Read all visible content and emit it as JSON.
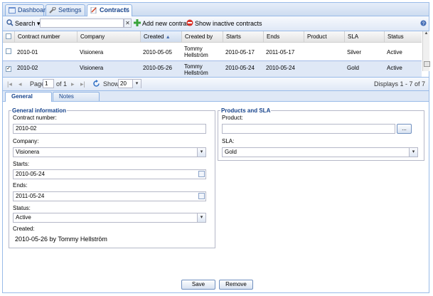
{
  "tabs": [
    {
      "label": "Dashboard",
      "icon": "dashboard-icon"
    },
    {
      "label": "Settings",
      "icon": "wrench-icon"
    },
    {
      "label": "Contracts",
      "icon": "contract-icon",
      "active": true
    }
  ],
  "toolbar": {
    "search_label": "Search",
    "search_value": "",
    "add_label": "Add new contract",
    "inactive_label": "Show inactive contracts"
  },
  "grid": {
    "columns": [
      "Contract number",
      "Company",
      "Created",
      "Created by",
      "Starts",
      "Ends",
      "Product",
      "SLA",
      "Status"
    ],
    "rows": [
      {
        "contract": "2010-01",
        "company": "Visionera",
        "created": "2010-05-05",
        "created_by": "Tommy Hellström",
        "starts": "2010-05-17",
        "ends": "2011-05-17",
        "product": "",
        "sla": "Silver",
        "status": "Active",
        "checked": false
      },
      {
        "contract": "2010-02",
        "company": "Visionera",
        "created": "2010-05-26",
        "created_by": "Tommy Hellström",
        "starts": "2010-05-24",
        "ends": "2010-05-24",
        "product": "",
        "sla": "Gold",
        "status": "Active",
        "checked": true
      }
    ]
  },
  "pager": {
    "page_label": "Page",
    "page_value": "1",
    "of_label": "of 1",
    "show_label": "Show",
    "show_value": "20",
    "displays": "Displays 1 - 7 of 7"
  },
  "detail_tabs": [
    "General",
    "Notes"
  ],
  "general": {
    "legend": "General information",
    "contract_label": "Contract number:",
    "contract_value": "2010-02",
    "company_label": "Company:",
    "company_value": "Visionera",
    "starts_label": "Starts:",
    "starts_value": "2010-05-24",
    "ends_label": "Ends:",
    "ends_value": "2011-05-24",
    "status_label": "Status:",
    "status_value": "Active",
    "created_label": "Created:",
    "created_value": "2010-05-26 by Tommy Hellström"
  },
  "products": {
    "legend": "Products and SLA",
    "product_label": "Product:",
    "product_value": "",
    "browse_label": "...",
    "sla_label": "SLA:",
    "sla_value": "Gold"
  },
  "buttons": {
    "save": "Save",
    "remove": "Remove"
  },
  "colors": {
    "accent": "#15428b",
    "border": "#99bbe8",
    "selected_row": "#dfe8f6"
  }
}
